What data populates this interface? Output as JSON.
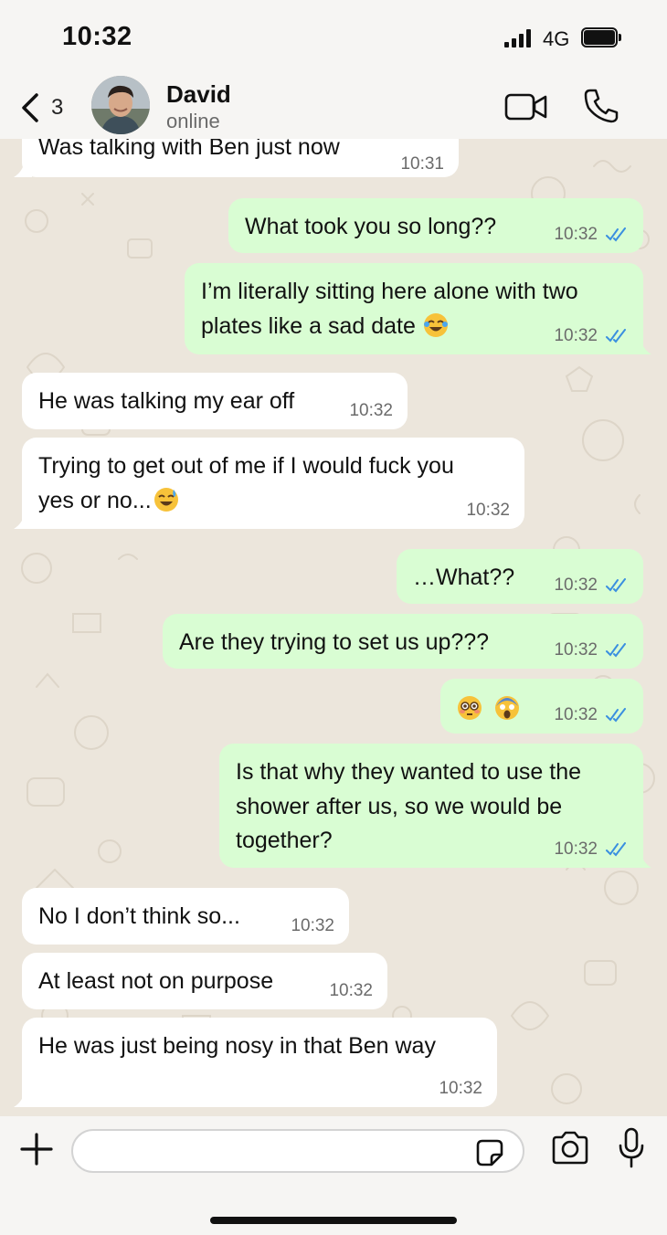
{
  "status_bar": {
    "time": "10:32",
    "network": "4G"
  },
  "header": {
    "back_count": "3",
    "contact_name": "David",
    "contact_status": "online"
  },
  "messages": [
    {
      "dir": "in",
      "lines": [
        "Was talking with Ben just now"
      ],
      "time": "10:31"
    },
    {
      "dir": "out",
      "lines": [
        "What took you so long??"
      ],
      "time": "10:32"
    },
    {
      "dir": "out",
      "lines": [
        "I’m literally sitting here alone with two",
        "plates like a sad date"
      ],
      "emoji": "face-with-tears-of-joy",
      "time": "10:32"
    },
    {
      "dir": "in",
      "lines": [
        "He was talking my ear off"
      ],
      "time": "10:32"
    },
    {
      "dir": "in",
      "lines": [
        "Trying to get out of me if I would fuck you",
        "yes or no..."
      ],
      "emoji": "grinning-face-with-sweat",
      "time": "10:32"
    },
    {
      "dir": "out",
      "lines": [
        "…What??"
      ],
      "time": "10:32"
    },
    {
      "dir": "out",
      "lines": [
        "Are they trying to set us up???"
      ],
      "time": "10:32"
    },
    {
      "dir": "out",
      "lines": [
        ""
      ],
      "emoji_only": [
        "flushed-face",
        "face-screaming-in-fear"
      ],
      "time": "10:32"
    },
    {
      "dir": "out",
      "lines": [
        "Is that why they wanted to use the",
        "shower after us, so we would be",
        "together?"
      ],
      "time": "10:32"
    },
    {
      "dir": "in",
      "lines": [
        "No I don’t think so..."
      ],
      "time": "10:32"
    },
    {
      "dir": "in",
      "lines": [
        "At least not on purpose"
      ],
      "time": "10:32"
    },
    {
      "dir": "in",
      "lines": [
        "He was just being nosy in that Ben way"
      ],
      "time": "10:32"
    }
  ],
  "composer": {
    "value": "",
    "placeholder": ""
  },
  "colors": {
    "incoming_bubble": "#ffffff",
    "outgoing_bubble": "#d9fdd3",
    "read_ticks": "#3a8fe0",
    "chat_background": "#ece6dc",
    "bar_background": "#f6f5f3"
  },
  "icons": {
    "back": "chevron-left-icon",
    "video": "video-camera-icon",
    "call": "phone-icon",
    "attach": "plus-icon",
    "sticker": "sticker-icon",
    "camera": "camera-icon",
    "mic": "microphone-icon"
  }
}
